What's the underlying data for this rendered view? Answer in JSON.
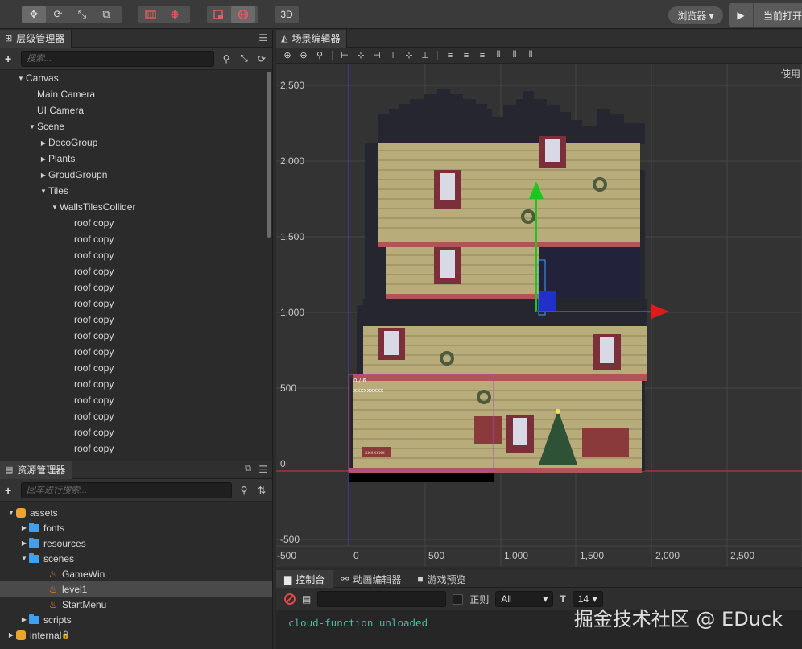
{
  "toolbar": {
    "three_d_label": "3D",
    "browser_label": "浏览器 ▾",
    "play_label": "当前打开"
  },
  "hierarchy": {
    "title": "层级管理器",
    "search_placeholder": "搜索...",
    "items": [
      {
        "label": "Canvas",
        "arrow": "▼"
      },
      {
        "label": "Main Camera",
        "arrow": ""
      },
      {
        "label": "UI Camera",
        "arrow": ""
      },
      {
        "label": "Scene",
        "arrow": "▼"
      },
      {
        "label": "DecoGroup",
        "arrow": "▶"
      },
      {
        "label": "Plants",
        "arrow": "▶"
      },
      {
        "label": "GroudGroupn",
        "arrow": "▶"
      },
      {
        "label": "Tiles",
        "arrow": "▼"
      },
      {
        "label": "WallsTilesCollider",
        "arrow": "▼"
      },
      {
        "label": "roof copy",
        "arrow": ""
      },
      {
        "label": "roof copy",
        "arrow": ""
      },
      {
        "label": "roof copy",
        "arrow": ""
      },
      {
        "label": "roof copy",
        "arrow": ""
      },
      {
        "label": "roof copy",
        "arrow": ""
      },
      {
        "label": "roof copy",
        "arrow": ""
      },
      {
        "label": "roof copy",
        "arrow": ""
      },
      {
        "label": "roof copy",
        "arrow": ""
      },
      {
        "label": "roof copy",
        "arrow": ""
      },
      {
        "label": "roof copy",
        "arrow": ""
      },
      {
        "label": "roof copy",
        "arrow": ""
      },
      {
        "label": "roof copy",
        "arrow": ""
      },
      {
        "label": "roof copy",
        "arrow": ""
      },
      {
        "label": "roof copy",
        "arrow": ""
      },
      {
        "label": "roof copy",
        "arrow": ""
      }
    ]
  },
  "assets": {
    "title": "资源管理器",
    "search_placeholder": "回车进行搜索...",
    "items": [
      {
        "label": "assets",
        "arrow": "▼",
        "icon": "db"
      },
      {
        "label": "fonts",
        "arrow": "▶",
        "icon": "folder"
      },
      {
        "label": "resources",
        "arrow": "▶",
        "icon": "folder"
      },
      {
        "label": "scenes",
        "arrow": "▼",
        "icon": "folder"
      },
      {
        "label": "GameWin",
        "arrow": "",
        "icon": "fire"
      },
      {
        "label": "level1",
        "arrow": "",
        "icon": "fire"
      },
      {
        "label": "StartMenu",
        "arrow": "",
        "icon": "fire"
      },
      {
        "label": "scripts",
        "arrow": "▶",
        "icon": "folder"
      },
      {
        "label": "internal",
        "arrow": "▶",
        "icon": "db"
      }
    ],
    "lock_icon": "lock-icon"
  },
  "scene": {
    "title": "场景编辑器",
    "usage_hint": "使用",
    "axis_y": [
      "2,500",
      "2,000",
      "1,500",
      "1,000",
      "500",
      "0",
      "-500"
    ],
    "axis_x": [
      "-500",
      "0",
      "500",
      "1,000",
      "1,500",
      "2,000",
      "2,500"
    ],
    "overlay_fps": "0 / 6",
    "overlay_label": "xxxxxxxxx",
    "sign_label": "xxxxxxx"
  },
  "console": {
    "tabs": [
      "控制台",
      "动画编辑器",
      "游戏预览"
    ],
    "regex_label": "正则",
    "level_value": "All",
    "font_size_value": "14",
    "log_line": "cloud-function unloaded"
  },
  "watermark": "掘金技术社区 @ EDuck",
  "colors": {
    "background": "#2b2b2b",
    "panel": "#3a3a3a",
    "accent_gizmo_green": "#1fc51f",
    "accent_gizmo_red": "#e01a1a",
    "accent_gizmo_blue": "#2030c8",
    "log_text": "#3dbfa0",
    "folder": "#3ea0ee"
  }
}
